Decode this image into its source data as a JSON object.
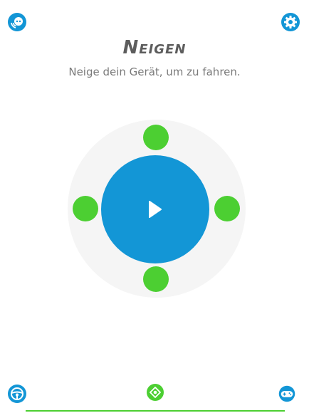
{
  "header": {
    "title": "Neigen",
    "subtitle": "Neige dein Gerät, um zu fahren."
  },
  "icons": {
    "top_left": "connect-robot-icon",
    "top_right": "gear-icon",
    "play": "play-icon",
    "bottom_left": "steering-wheel-icon",
    "bottom_center": "tilt-mode-icon",
    "bottom_right": "gamepad-icon"
  },
  "colors": {
    "primary_blue": "#1396d6",
    "accent_green": "#4ccf32",
    "pad_background": "#f5f5f5",
    "title_gray": "#5d5d5d",
    "subtitle_gray": "#7a7a7a"
  }
}
